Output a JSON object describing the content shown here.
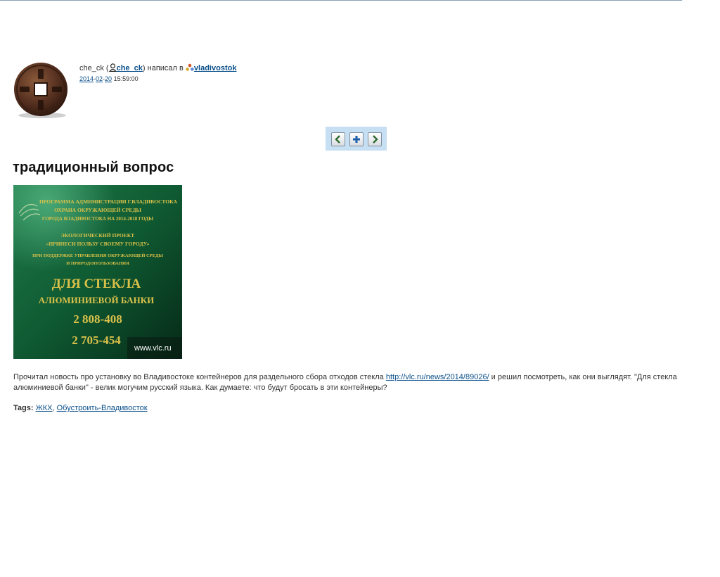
{
  "colors": {
    "link": "#0a4f8a",
    "nav_bg": "#c7dff2",
    "photo_green": "#0f5a32",
    "photo_text": "#d9c14a"
  },
  "post": {
    "author_name": "che_ck",
    "open_paren": " (",
    "author_link": "che_ck",
    "wrote_in": ") написал в ",
    "community": "vladivostok",
    "date_year": "2014",
    "date_month": "02",
    "date_day": "20",
    "time": " 15:59:00",
    "title": "традиционный вопрос",
    "text_before_link": "Прочитал новость про установку во Владивостоке контейнеров для раздельного сбора отходов стекла ",
    "link_url_text": "http://vlc.ru/news/2014/89026/",
    "text_after_link": " и решил посмотреть, как они выглядят. \"Для стекла алюминиевой банки\" - велик могучим русский языка. Как думаете: что будут бросать в эти контейнеры?",
    "tags_label": "Tags:",
    "tags": [
      "ЖКХ",
      "Обустроить-Владивосток"
    ],
    "tag_separator": ", "
  },
  "nav": {
    "prev_icon": "arrow-left-icon",
    "add_icon": "plus-icon",
    "next_icon": "arrow-right-icon"
  },
  "photo": {
    "lines": [
      "ПРОГРАММА АДМИНИСТРАЦИИ Г.ВЛАДИВОСТОКА",
      "ОХРАНА ОКРУЖАЮЩЕЙ СРЕДЫ",
      "ГОРОДА ВЛАДИВОСТОКА НА 2014-2018 ГОДЫ",
      "ЭКОЛОГИЧЕСКИЙ ПРОЕКТ",
      "«ПРИНЕСИ ПОЛЬЗУ СВОЕМУ ГОРОДУ»",
      "ПРИ ПОДДЕРЖКЕ УПРАВЛЕНИЯ ОКРУЖАЮЩЕЙ СРЕДЫ",
      "И ПРИРОДОПОЛЬЗОВАНИЯ",
      "ДЛЯ СТЕКЛА",
      "АЛЮМИНИЕВОЙ БАНКИ",
      "2 808-408",
      "2 705-454"
    ],
    "watermark": "www.vlc.ru"
  }
}
